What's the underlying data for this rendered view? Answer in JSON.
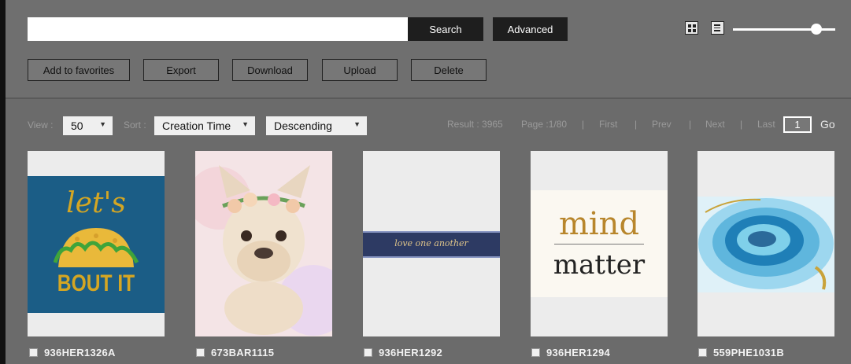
{
  "search": {
    "placeholder": "",
    "value": "",
    "button_label": "Search",
    "advanced_label": "Advanced"
  },
  "view_controls": {
    "grid_icon": "grid-view-icon",
    "list_icon": "list-view-icon",
    "size_slider_level": 0.83
  },
  "actions": [
    "Add to favorites",
    "Export",
    "Download",
    "Upload",
    "Delete"
  ],
  "toolbar": {
    "view_label": "View :",
    "view_value": "50",
    "sort_label": "Sort :",
    "sort_field": "Creation Time",
    "sort_order": "Descending"
  },
  "pagination": {
    "result": "Result : 3965",
    "page": "Page :1/80",
    "sep": "|",
    "first": "First",
    "prev": "Prev",
    "next": "Next",
    "last": "Last",
    "page_input": "1",
    "go": "Go"
  },
  "items": [
    {
      "id": "936HER1326A",
      "art": {
        "line1": "let's",
        "line2": "BOUT IT"
      }
    },
    {
      "id": "673BAR1115"
    },
    {
      "id": "936HER1292",
      "art": {
        "text": "love one another"
      }
    },
    {
      "id": "936HER1294",
      "art": {
        "line1": "mind",
        "line2": "matter"
      }
    },
    {
      "id": "559PHE1031B"
    }
  ],
  "colors": {
    "background": "#6b6b6b",
    "dark_button": "#1e1e1e",
    "card": "#ececec",
    "taco_bg": "#1b5d86",
    "taco_text": "#d4a623",
    "gold": "#b8862c"
  }
}
